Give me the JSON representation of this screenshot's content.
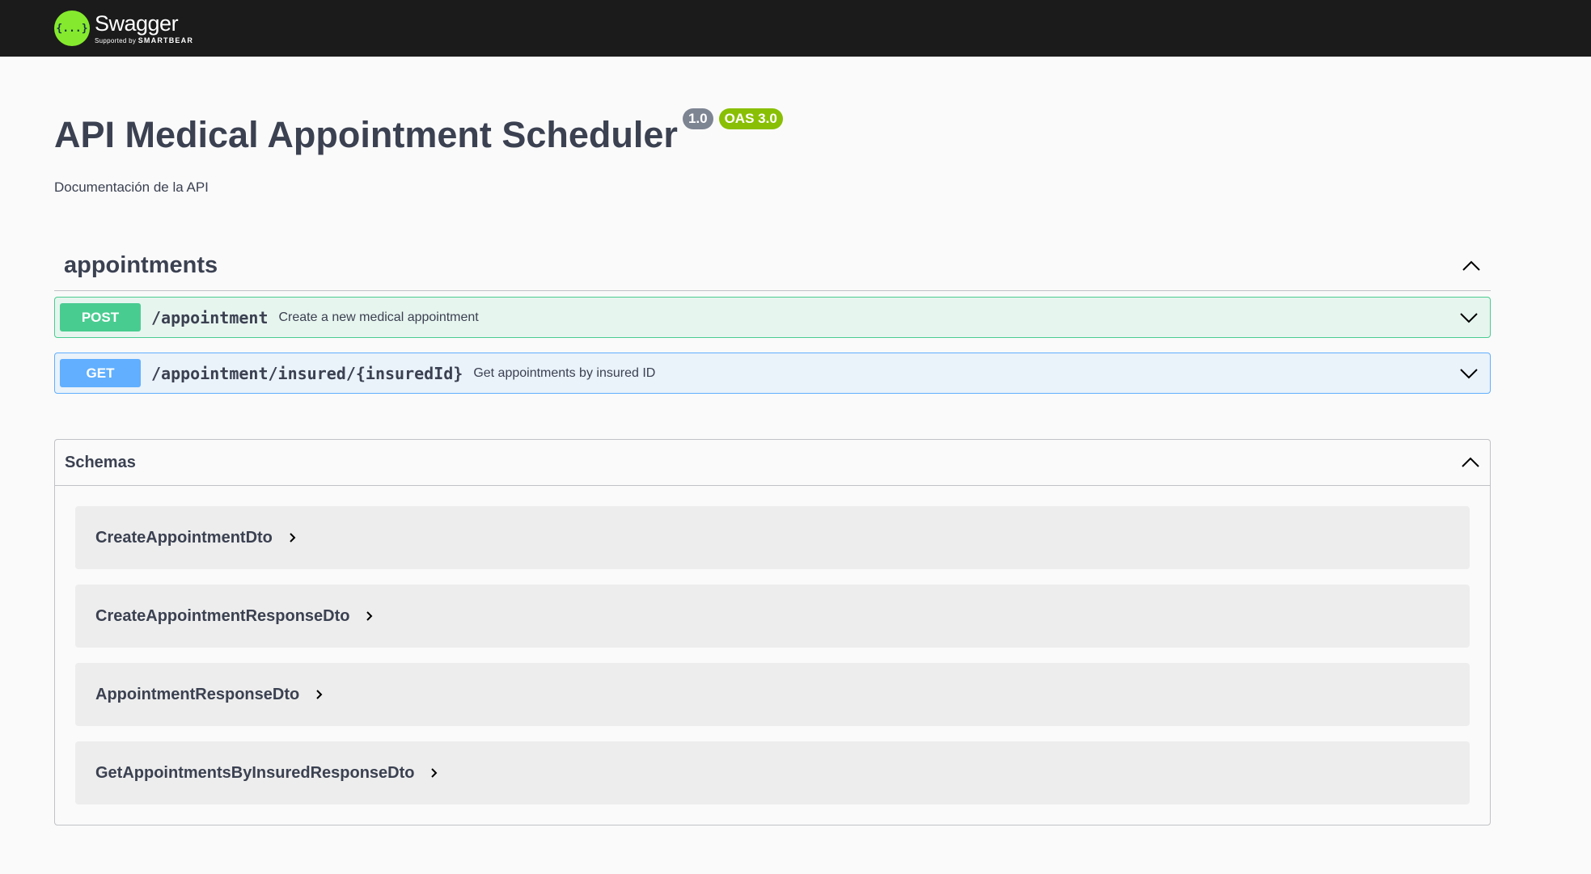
{
  "topbar": {
    "brand": "Swagger",
    "supported_by": "Supported by",
    "company": "SMARTBEAR",
    "logo_icon": "swagger-logo-icon",
    "logo_glyph": "{...}"
  },
  "info": {
    "title": "API Medical Appointment Scheduler",
    "version": "1.0",
    "oas": "OAS 3.0",
    "description": "Documentación de la API"
  },
  "tag": {
    "name": "appointments",
    "expanded_icon": "chevron-up-icon",
    "operations": [
      {
        "method": "POST",
        "path": "/appointment",
        "summary": "Create a new medical appointment",
        "color": "#49cc90"
      },
      {
        "method": "GET",
        "path": "/appointment/insured/{insuredId}",
        "summary": "Get appointments by insured ID",
        "color": "#61affe"
      }
    ]
  },
  "schemas": {
    "title": "Schemas",
    "models": [
      {
        "name": "CreateAppointmentDto"
      },
      {
        "name": "CreateAppointmentResponseDto"
      },
      {
        "name": "AppointmentResponseDto"
      },
      {
        "name": "GetAppointmentsByInsuredResponseDto"
      }
    ]
  },
  "colors": {
    "topbar_bg": "#1b1b1b",
    "logo_green": "#85ea2d",
    "post": "#49cc90",
    "get": "#61affe",
    "version_badge": "#7d8492",
    "oas_badge": "#89bf04"
  }
}
